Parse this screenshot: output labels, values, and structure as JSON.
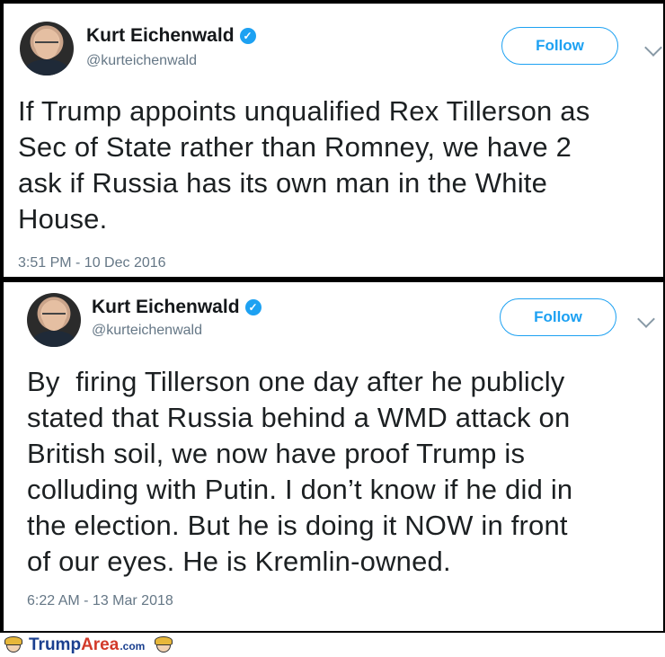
{
  "tweets": [
    {
      "name": "Kurt Eichenwald",
      "handle": "@kurteichenwald",
      "follow_label": "Follow",
      "text": "If Trump appoints unqualified Rex Tillerson as\nSec of State rather than Romney, we have 2\nask if Russia has its own man in the White\nHouse.",
      "time": "3:51 PM - 10 Dec 2016"
    },
    {
      "name": "Kurt Eichenwald",
      "handle": "@kurteichenwald",
      "follow_label": "Follow",
      "text": "By  firing Tillerson one day after he publicly\nstated that Russia behind a WMD attack on\nBritish soil, we now have proof Trump is\ncolluding with Putin. I don’t know if he did in\nthe election. But he is doing it NOW in front\nof our eyes. He is Kremlin-owned.",
      "time": "6:22 AM - 13 Mar 2018"
    }
  ],
  "footer": {
    "brand_part1": "Trump",
    "brand_part2": "Area",
    "brand_suffix": ".com"
  },
  "colors": {
    "accent": "#1da1f2",
    "text": "#1c2022",
    "muted": "#657786"
  },
  "icons": {
    "verified": "verified-badge-icon",
    "chevron": "chevron-down-icon",
    "mascot": "trump-mascot-icon"
  }
}
